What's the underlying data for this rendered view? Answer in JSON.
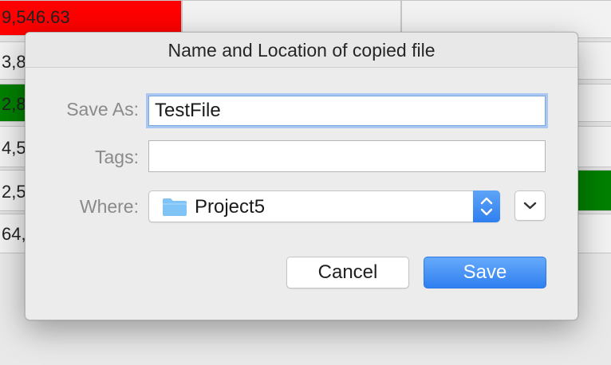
{
  "background": {
    "cells": [
      "9,546.63",
      "3,8",
      "2,8",
      "4,5",
      "2,5",
      "64,"
    ],
    "colors": {
      "red": "#ff0000",
      "green": "#008000",
      "cell": "#f2f2f2"
    }
  },
  "dialog": {
    "title": "Name and Location of copied file",
    "save_as": {
      "label": "Save As:",
      "value": "TestFile"
    },
    "tags": {
      "label": "Tags:",
      "value": ""
    },
    "where": {
      "label": "Where:",
      "value": "Project5",
      "icon": "folder-icon"
    },
    "expand_icon": "chevron-down-icon",
    "buttons": {
      "cancel": "Cancel",
      "save": "Save"
    },
    "colors": {
      "accent": "#2f7ff0",
      "folder": "#7fc3f7"
    }
  }
}
